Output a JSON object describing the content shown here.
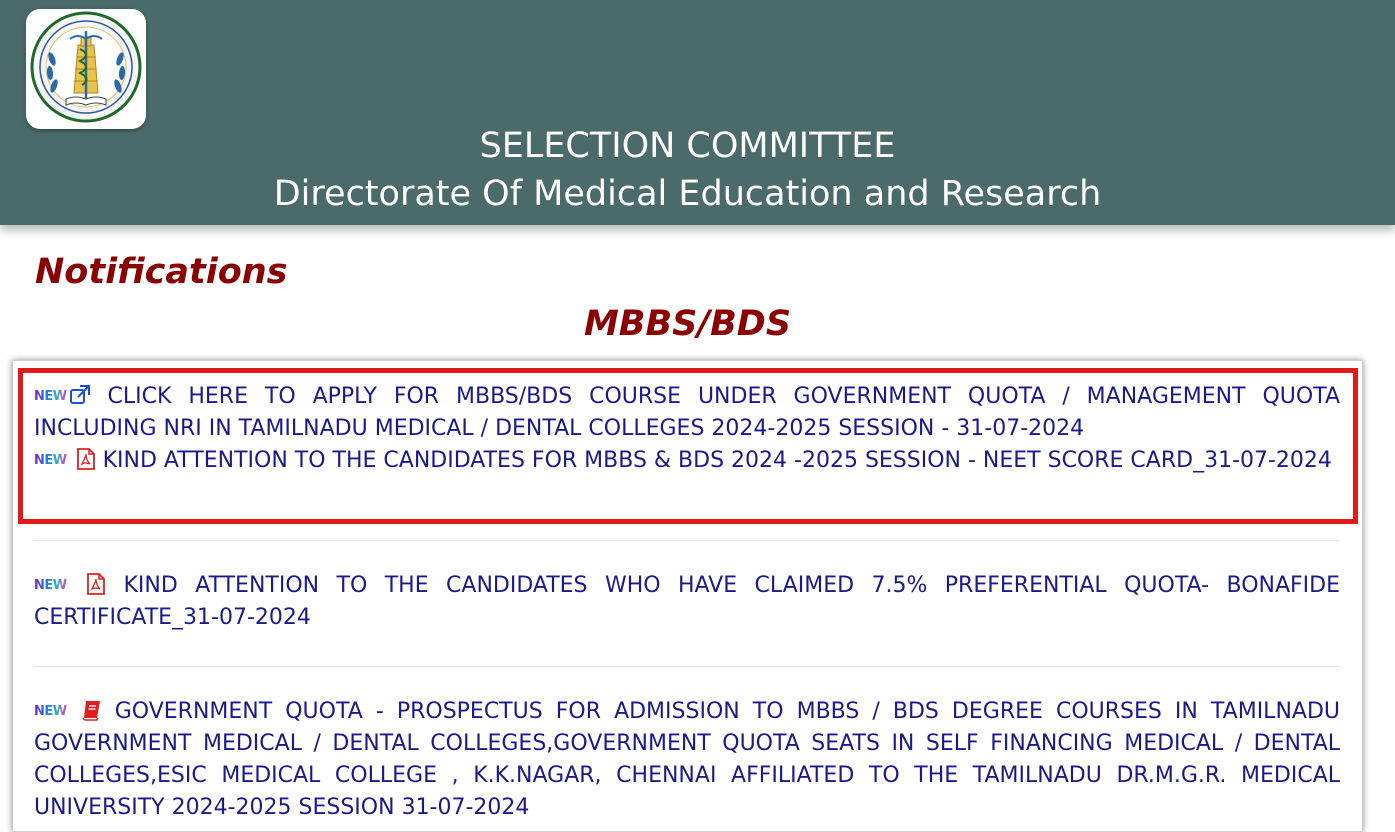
{
  "header": {
    "title": "SELECTION COMMITTEE",
    "subtitle": "Directorate Of Medical Education and Research",
    "logo_icon": "dme-emblem-logo"
  },
  "notifications_heading": "Notifications",
  "section_heading": "MBBS/BDS",
  "colors": {
    "header_bg": "#4a6b6a",
    "heading": "#8b0000",
    "link": "#1a1a8c",
    "highlight_border": "#e01a1a"
  },
  "notices": [
    {
      "badge": "NEW",
      "icon": "external-link-icon",
      "text": "CLICK HERE TO APPLY FOR MBBS/BDS COURSE UNDER GOVERNMENT QUOTA / MANAGEMENT QUOTA INCLUDING NRI IN TAMILNADU MEDICAL / DENTAL COLLEGES 2024-2025 SESSION - 31-07-2024"
    },
    {
      "badge": "NEW",
      "icon": "pdf-icon",
      "text": "KIND ATTENTION TO THE CANDIDATES FOR MBBS & BDS 2024 -2025 SESSION - NEET SCORE CARD_31-07-2024"
    },
    {
      "badge": "NEW",
      "icon": "pdf-icon",
      "text": "KIND ATTENTION TO THE CANDIDATES WHO HAVE CLAIMED 7.5% PREFERENTIAL QUOTA- BONAFIDE CERTIFICATE_31-07-2024"
    },
    {
      "badge": "NEW",
      "icon": "book-icon",
      "text": "GOVERNMENT QUOTA - PROSPECTUS FOR ADMISSION TO MBBS / BDS DEGREE COURSES IN TAMILNADU GOVERNMENT MEDICAL / DENTAL COLLEGES,GOVERNMENT QUOTA SEATS IN SELF FINANCING MEDICAL / DENTAL COLLEGES,ESIC MEDICAL COLLEGE , K.K.NAGAR, CHENNAI AFFILIATED TO THE TAMILNADU DR.M.G.R. MEDICAL UNIVERSITY 2024-2025 SESSION 31-07-2024"
    }
  ]
}
